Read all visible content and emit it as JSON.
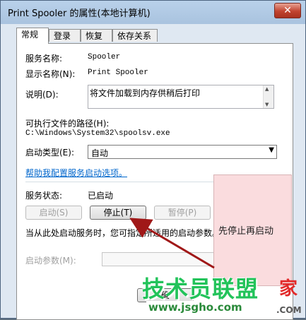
{
  "window": {
    "title": "Print Spooler 的属性(本地计算机)",
    "close_glyph": "✕"
  },
  "tabs": [
    {
      "label": "常规",
      "active": true
    },
    {
      "label": "登录",
      "active": false
    },
    {
      "label": "恢复",
      "active": false
    },
    {
      "label": "依存关系",
      "active": false
    }
  ],
  "general": {
    "service_name_label": "服务名称:",
    "service_name_value": "Spooler",
    "display_name_label": "显示名称(N):",
    "display_name_value": "Print Spooler",
    "description_label": "说明(D):",
    "description_value": "将文件加载到内存供稍后打印",
    "path_label": "可执行文件的路径(H):",
    "path_value": "C:\\Windows\\System32\\spoolsv.exe",
    "startup_type_label": "启动类型(E):",
    "startup_type_value": "自动",
    "help_link": "帮助我配置服务启动选项。",
    "status_label": "服务状态:",
    "status_value": "已启动",
    "buttons": {
      "start": "启动(S)",
      "stop": "停止(T)",
      "pause": "暂停(P)"
    },
    "hint_text": "当从此处启动服务时，您可指定所适用的启动参数。",
    "start_params_label": "启动参数(M):",
    "start_params_value": ""
  },
  "footer": {
    "ok_label": "确"
  },
  "annotation": {
    "callout_text": "先停止再启动",
    "arrow_color": "#a01818"
  },
  "watermark": {
    "text": "技术员联盟",
    "jia": "家",
    "url": "www.jsgho.com",
    "com": ".COM"
  }
}
